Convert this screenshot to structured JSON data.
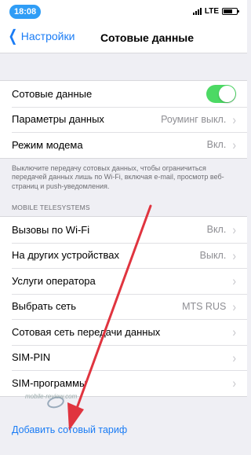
{
  "status": {
    "time": "18:08",
    "network": "LTE"
  },
  "nav": {
    "back_label": "Настройки",
    "title": "Сотовые данные"
  },
  "group1": [
    {
      "label": "Сотовые данные",
      "toggle": true
    },
    {
      "label": "Параметры данных",
      "value": "Роуминг выкл."
    },
    {
      "label": "Режим модема",
      "value": "Вкл."
    }
  ],
  "footnote": "Выключите передачу сотовых данных, чтобы ограничиться передачей данных лишь по Wi-Fi, включая e-mail, просмотр веб-страниц и push-уведомления.",
  "section_header": "MOBILE TELESYSTEMS",
  "group2": [
    {
      "label": "Вызовы по Wi-Fi",
      "value": "Вкл."
    },
    {
      "label": "На других устройствах",
      "value": "Выкл."
    },
    {
      "label": "Услуги оператора",
      "value": ""
    },
    {
      "label": "Выбрать сеть",
      "value": "MTS RUS"
    },
    {
      "label": "Сотовая сеть передачи данных",
      "value": ""
    },
    {
      "label": "SIM-PIN",
      "value": ""
    },
    {
      "label": "SIM-программы",
      "value": ""
    }
  ],
  "add_plan_label": "Добавить сотовый тариф",
  "watermark": "mobile-review.com",
  "colors": {
    "accent": "#1a7cf5",
    "toggle_on": "#4cd964",
    "arrow": "#e0343f"
  }
}
